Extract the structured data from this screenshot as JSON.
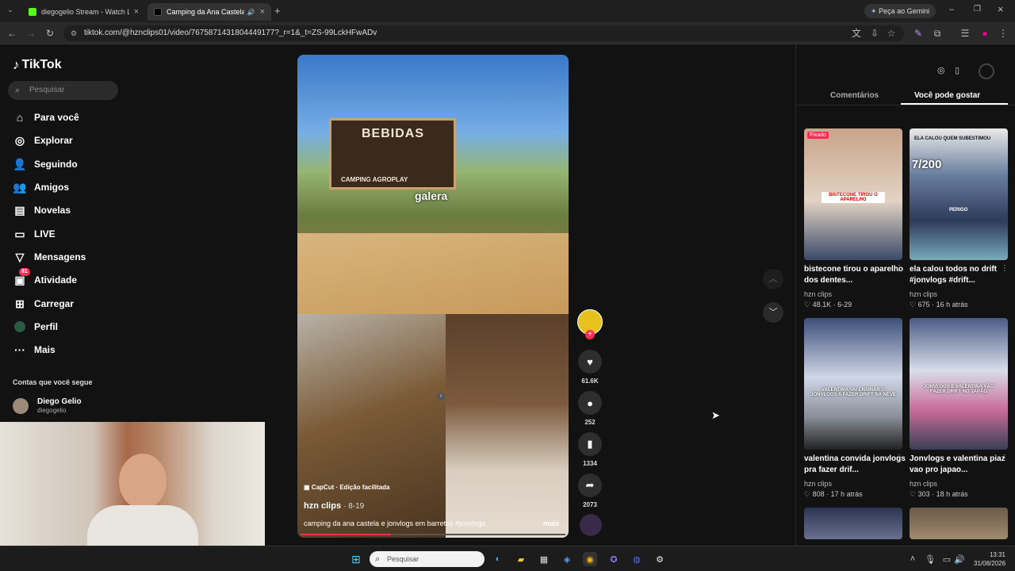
{
  "browser": {
    "tabs": [
      {
        "label": "diegogelio Stream - Watch Live"
      },
      {
        "label": "Camping da Ana Castela e"
      }
    ],
    "url": "tiktok.com/@hznclips01/video/7675871431804449177?_r=1&_t=ZS-99LckHFwADv",
    "gemini_label": "Peça ao Gemini"
  },
  "sidebar": {
    "logo": "TikTok",
    "search_placeholder": "Pesquisar",
    "items": [
      {
        "label": "Para você",
        "icon": "home-icon"
      },
      {
        "label": "Explorar",
        "icon": "compass-icon"
      },
      {
        "label": "Seguindo",
        "icon": "following-icon"
      },
      {
        "label": "Amigos",
        "icon": "friends-icon"
      },
      {
        "label": "Novelas",
        "icon": "novelas-icon"
      },
      {
        "label": "LIVE",
        "icon": "live-icon"
      },
      {
        "label": "Mensagens",
        "icon": "messages-icon"
      },
      {
        "label": "Atividade",
        "icon": "activity-icon",
        "badge": "81"
      },
      {
        "label": "Carregar",
        "icon": "upload-icon"
      },
      {
        "label": "Perfil",
        "icon": "profile-icon"
      },
      {
        "label": "Mais",
        "icon": "more-icon"
      }
    ],
    "following_heading": "Contas que você segue",
    "following": [
      {
        "name": "Diego Gelio",
        "handle": "diegogelio"
      }
    ]
  },
  "video": {
    "caption_top": "galera",
    "sign_text": "BEBIDAS",
    "sign_sub": "CAMPING AGROPLAY",
    "capcut_label": "CapCut · Edição facilitada",
    "author": "hzn clips",
    "date": "· 8-19",
    "description": "camping da ana castela e jonvlogs em barretos #jonvlogs",
    "more": "mais",
    "progress": 0.34
  },
  "actions": {
    "likes": "61.6K",
    "comments": "252",
    "saves": "1334",
    "shares": "2073"
  },
  "right_panel": {
    "tabs": [
      "Comentários",
      "Você pode gostar"
    ],
    "active_tab": 1,
    "videos": [
      {
        "title": "bistecone tirou o aparelho dos dentes...",
        "author": "hzn clips",
        "likes": "48.1K",
        "time": "6-29",
        "pinned": "Fixado",
        "overlay": "BISTECONE TIROU O APARELHO"
      },
      {
        "title": "ela calou todos no drift #jonvlogs #drift...",
        "author": "hzn clips",
        "likes": "675",
        "time": "16 h atrás",
        "overlay": "ELA CALOU QUEM SUBESTIMOU",
        "overlay2": "Subs: 7/200",
        "overlay3": "PERIGO"
      },
      {
        "title": "valentina convida jonvlogs pra fazer drif...",
        "author": "hzn clips",
        "likes": "808",
        "time": "17 h atrás",
        "overlay": "VALENTINA VAI ENSINAR O JONVLOGS A FAZER DRIFT NA NEVE"
      },
      {
        "title": "Jonvlogs e valentina piaz vao pro japao...",
        "author": "hzn clips",
        "likes": "303",
        "time": "18 h atrás",
        "overlay": "JONVLOGS E VALENTINA VÃO FAZER DRIFT NO JAPÃO"
      }
    ]
  },
  "taskbar": {
    "search_placeholder": "Pesquisar",
    "time": "13:31",
    "date": "31/08/2026"
  }
}
